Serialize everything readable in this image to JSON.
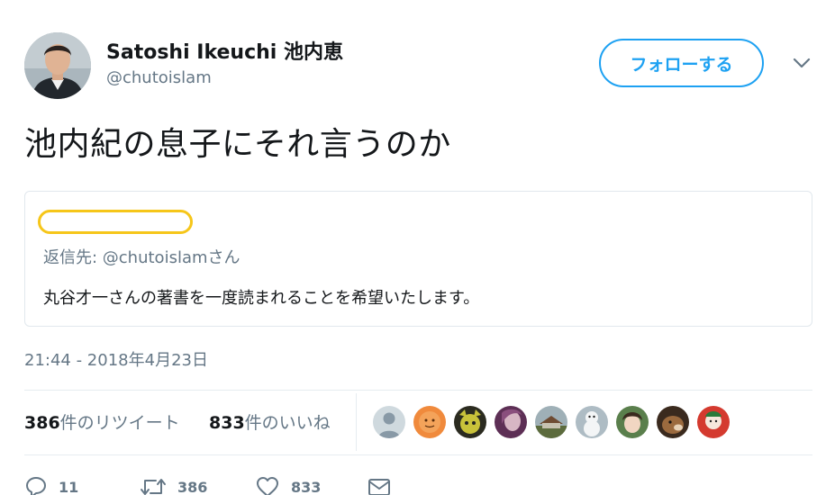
{
  "author": {
    "name": "Satoshi Ikeuchi 池内恵",
    "handle": "@chutoislam"
  },
  "follow_button_label": "フォローする",
  "tweet_text": "池内紀の息子にそれ言うのか",
  "quoted_tweet": {
    "reply_to_label": "返信先: @chutoislamさん",
    "body": "丸谷才一さんの著書を一度読まれることを希望いたします。"
  },
  "timestamp": "21:44 - 2018年4月23日",
  "stats": {
    "retweets_count": "386",
    "retweets_label": "件のリツイート",
    "likes_count": "833",
    "likes_label": "件のいいね"
  },
  "likers": [
    {
      "icon": "default-avatar",
      "color": "#cfd9de"
    },
    {
      "icon": "orange-face-avatar",
      "color": "#f08a3c"
    },
    {
      "icon": "cartoon-face-avatar",
      "color": "#c9c23a"
    },
    {
      "icon": "portrait-avatar",
      "color": "#8a4f7d"
    },
    {
      "icon": "building-avatar",
      "color": "#6e7a5a"
    },
    {
      "icon": "snowman-avatar",
      "color": "#d9dde0"
    },
    {
      "icon": "anime-avatar",
      "color": "#5a7f4c"
    },
    {
      "icon": "dog-avatar",
      "color": "#7a5434"
    },
    {
      "icon": "doll-avatar",
      "color": "#d43a2f"
    }
  ],
  "actions": {
    "reply_count": "11",
    "retweet_count": "386",
    "like_count": "833"
  },
  "colors": {
    "accent": "#1da1f2",
    "secondary_text": "#657786",
    "highlight_outline": "#f6c619"
  }
}
